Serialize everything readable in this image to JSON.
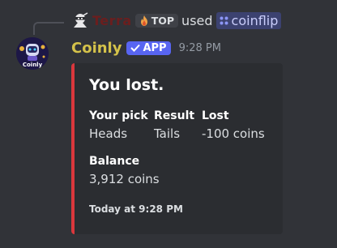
{
  "reply": {
    "username": "Terra",
    "role_tag": "TOP",
    "action_text": "used",
    "command": "coinflip"
  },
  "message": {
    "username": "Coinly",
    "badge": "APP",
    "timestamp": "9:28 PM",
    "avatar_text": "Coinly"
  },
  "embed": {
    "accent_color": "#da373c",
    "title": "You lost.",
    "fields": [
      {
        "name": "Your pick",
        "value": "Heads"
      },
      {
        "name": "Result",
        "value": "Tails"
      },
      {
        "name": "Lost",
        "value": "-100 coins"
      }
    ],
    "balance": {
      "name": "Balance",
      "value": "3,912 coins"
    },
    "footer": "Today at 9:28 PM"
  },
  "icons": {
    "reply_avatar": "ninja-avatar-icon",
    "role": "flame-icon",
    "command": "slash-command-icon",
    "badge": "checkmark-icon"
  }
}
